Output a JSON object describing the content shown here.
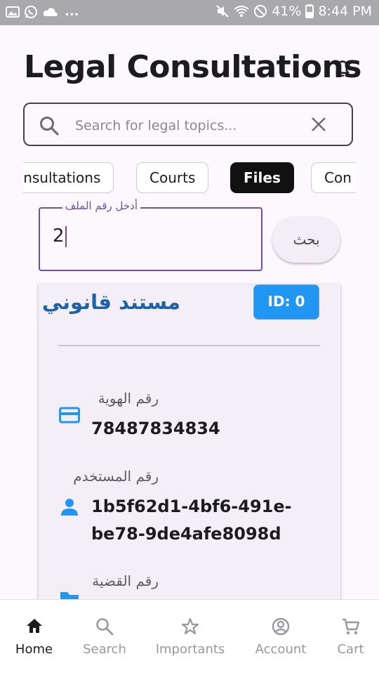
{
  "status_bar": {
    "battery": "41%",
    "time": "8:44 PM",
    "overflow": "..."
  },
  "header": {
    "title": "Legal Consultations"
  },
  "search": {
    "placeholder": "Search for legal topics..."
  },
  "categories": [
    {
      "label": "Consultations",
      "selected": false
    },
    {
      "label": "Courts",
      "selected": false
    },
    {
      "label": "Files",
      "selected": true
    },
    {
      "label": "Con",
      "selected": false
    }
  ],
  "file_search": {
    "label": "أدخل رقم الملف",
    "value": "2",
    "button_label": "بحث"
  },
  "document": {
    "title": "مستند قانوني",
    "id_badge": "ID: 0",
    "fields": [
      {
        "label": "رقم الهوية",
        "value": "78487834834",
        "icon": "id-card-icon"
      },
      {
        "label": "رقم المستخدم",
        "value_line1": "1b5f62d1-4bf6-491e-",
        "value_line2": "be78-9de4afe8098d",
        "icon": "person-icon"
      },
      {
        "label": "رقم القضية",
        "icon": "folder-icon"
      }
    ]
  },
  "bottom_nav": [
    {
      "label": "Home",
      "icon": "home-icon",
      "active": true
    },
    {
      "label": "Search",
      "icon": "search-icon",
      "active": false
    },
    {
      "label": "Importants",
      "icon": "star-icon",
      "active": false
    },
    {
      "label": "Account",
      "icon": "account-icon",
      "active": false
    },
    {
      "label": "Cart",
      "icon": "cart-icon",
      "active": false
    }
  ],
  "colors": {
    "accent_blue": "#2196f3",
    "title_blue": "#1e63a8",
    "focus_purple": "#6b4fa1",
    "selected_chip": "#111111"
  }
}
